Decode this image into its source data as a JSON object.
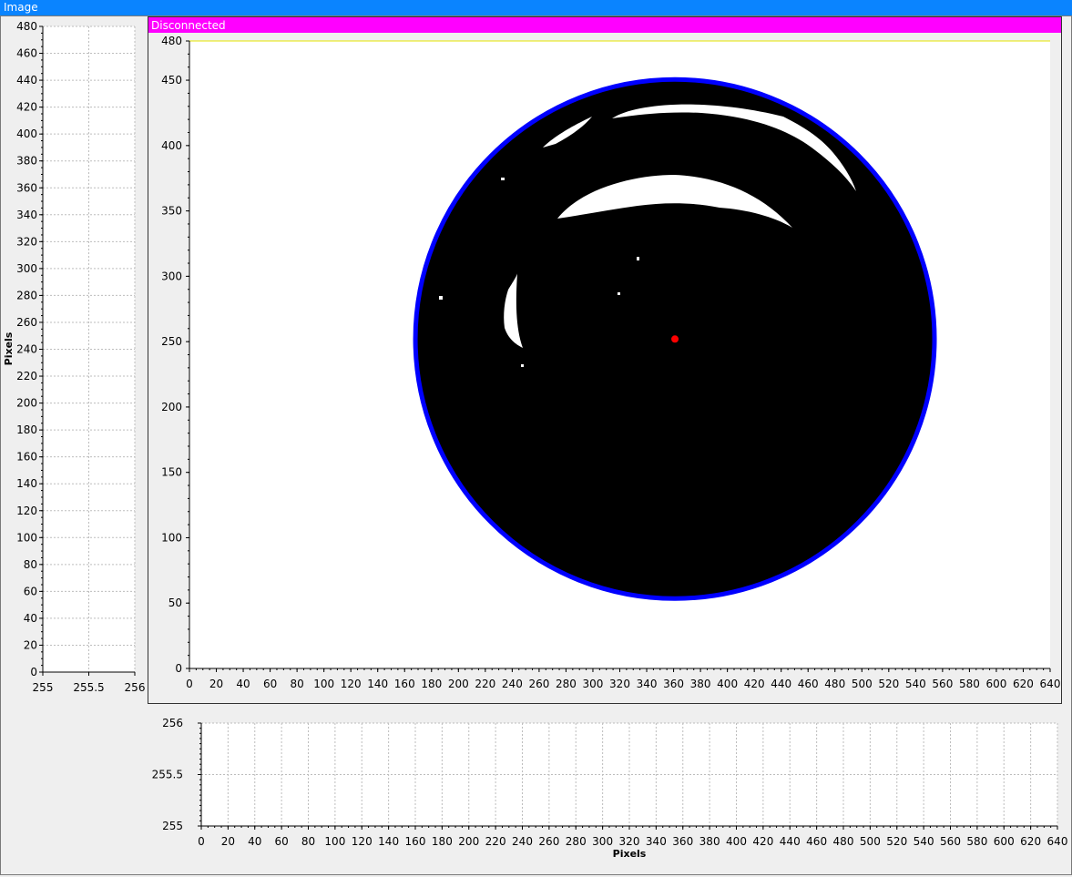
{
  "window": {
    "title": "Image"
  },
  "status": {
    "text": "Disconnected",
    "color": "#ff00ff"
  },
  "colors": {
    "circle": "#0000ff",
    "centroid": "#ff0000",
    "background": "#ffffff",
    "mask": "#000000"
  },
  "main_plot": {
    "xlim": [
      0,
      640
    ],
    "ylim": [
      0,
      480
    ],
    "x_ticks": [
      0,
      20,
      40,
      60,
      80,
      100,
      120,
      140,
      160,
      180,
      200,
      220,
      240,
      260,
      280,
      300,
      320,
      340,
      360,
      380,
      400,
      420,
      440,
      460,
      480,
      500,
      520,
      540,
      560,
      580,
      600,
      620,
      640
    ],
    "y_ticks": [
      0,
      50,
      100,
      150,
      200,
      250,
      300,
      350,
      400,
      450,
      480
    ],
    "circle": {
      "cx": 361,
      "cy": 252,
      "r": 193
    },
    "centroid": {
      "x": 361,
      "y": 252
    }
  },
  "left_profile": {
    "ylabel": "Pixels",
    "xlim": [
      255,
      256
    ],
    "x_tick_labels": [
      "255",
      "255.5",
      "256"
    ],
    "y_ticks": [
      0,
      20,
      40,
      60,
      80,
      100,
      120,
      140,
      160,
      180,
      200,
      220,
      240,
      260,
      280,
      300,
      320,
      340,
      360,
      380,
      400,
      420,
      440,
      460,
      480
    ]
  },
  "bottom_profile": {
    "xlabel": "Pixels",
    "ylim": [
      255,
      256
    ],
    "y_tick_labels": [
      "256",
      "255.5",
      "255"
    ],
    "x_ticks": [
      0,
      20,
      40,
      60,
      80,
      100,
      120,
      140,
      160,
      180,
      200,
      220,
      240,
      260,
      280,
      300,
      320,
      340,
      360,
      380,
      400,
      420,
      440,
      460,
      480,
      500,
      520,
      540,
      560,
      580,
      600,
      620,
      640
    ]
  }
}
